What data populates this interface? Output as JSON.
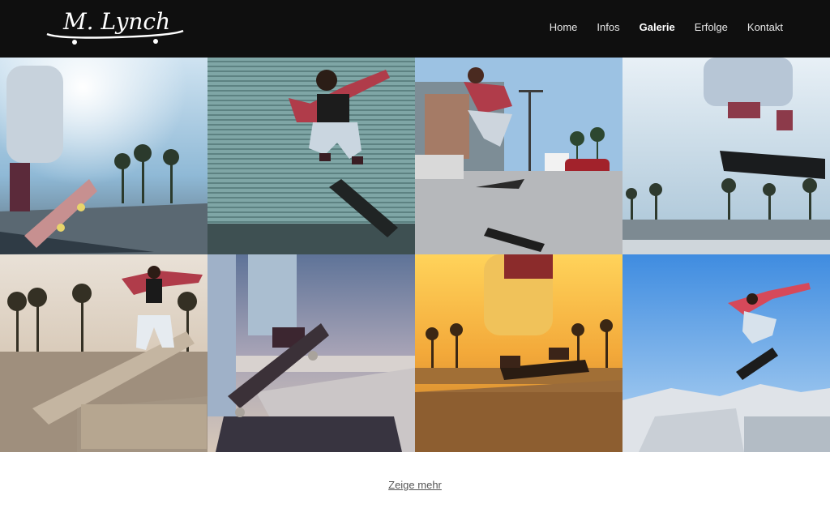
{
  "brand": {
    "logo_text": "M. Lynch"
  },
  "nav": {
    "items": [
      {
        "label": "Home"
      },
      {
        "label": "Infos"
      },
      {
        "label": "Galerie"
      },
      {
        "label": "Erfolge"
      },
      {
        "label": "Kontakt"
      }
    ],
    "active": "Galerie"
  },
  "gallery": {
    "photos": [
      {
        "subject": "skater-grinding-ledge-sunlit"
      },
      {
        "subject": "skater-kickflip-shutter-wall"
      },
      {
        "subject": "skater-street-jump-parking"
      },
      {
        "subject": "skater-board-flip-skatepark"
      },
      {
        "subject": "skater-rail-jump-palms"
      },
      {
        "subject": "skater-foot-on-board-closeup"
      },
      {
        "subject": "skater-grind-golden-hour"
      },
      {
        "subject": "skater-aerial-blue-sky"
      }
    ]
  },
  "show_more": {
    "label": "Zeige mehr"
  },
  "colors": {
    "header_bg": "#0f0f0f",
    "nav_text": "#e6e6e6",
    "link": "#555555"
  }
}
